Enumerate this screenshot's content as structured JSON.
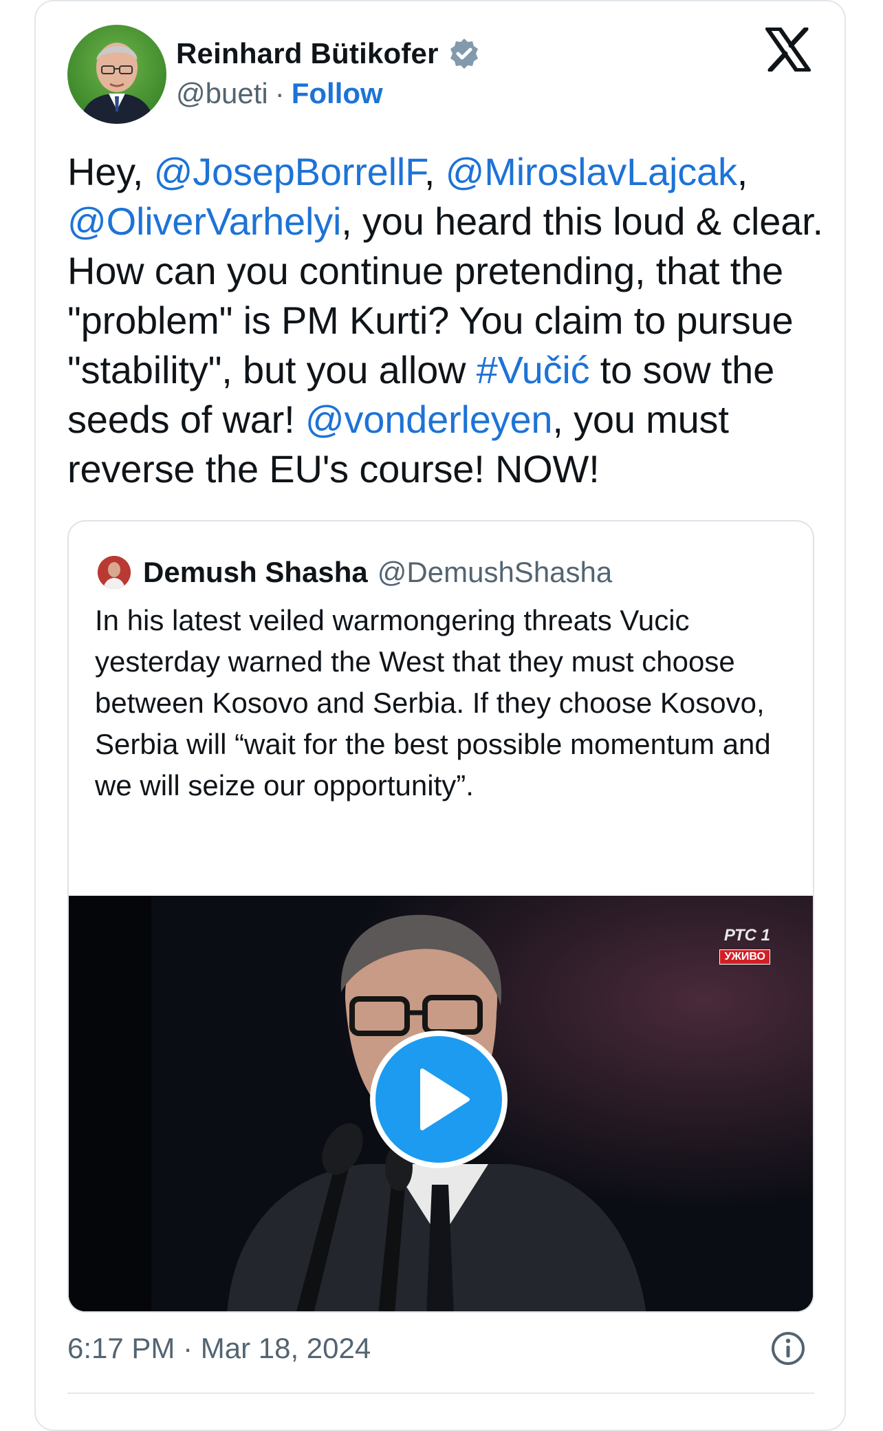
{
  "author": {
    "display_name": "Reinhard Bütikofer",
    "handle": "@bueti",
    "separator": "·",
    "follow_label": "Follow",
    "verified": true
  },
  "brand_icon": "x-logo-icon",
  "tweet": {
    "segments": [
      {
        "text": "Hey, ",
        "link": false
      },
      {
        "text": "@JosepBorrellF",
        "link": true
      },
      {
        "text": ", ",
        "link": false
      },
      {
        "text": "@MiroslavLajcak",
        "link": true
      },
      {
        "text": ", ",
        "link": false
      },
      {
        "text": "@OliverVarhelyi",
        "link": true
      },
      {
        "text": ", you heard this loud & clear. How can you continue pretending, that the \"problem\" is PM Kurti? You claim to pursue \"stability\", but you allow ",
        "link": false
      },
      {
        "text": "#Vučić",
        "link": true
      },
      {
        "text": " to sow the seeds of war! ",
        "link": false
      },
      {
        "text": "@vonderleyen",
        "link": true
      },
      {
        "text": ", you must reverse the EU's course! NOW!",
        "link": false
      }
    ]
  },
  "quoted": {
    "display_name": "Demush Shasha",
    "handle": "@DemushShasha",
    "text": "In his latest veiled warmongering threats Vucic yesterday warned the West that they must choose between Kosovo and Serbia. If they choose Kosovo, Serbia will “wait for the best possible momentum and we will seize our opportunity”.",
    "video": {
      "channel": "РТС",
      "channel_number": "1",
      "live_badge": "УЖИВО",
      "play_icon": "play-icon"
    }
  },
  "footer": {
    "timestamp": "6:17 PM · Mar 18, 2024",
    "info_icon": "info-icon"
  },
  "colors": {
    "link": "#1d73d6",
    "secondary_text": "#536471",
    "play_button": "#1d9bf0",
    "verified_badge": "#829aab"
  }
}
